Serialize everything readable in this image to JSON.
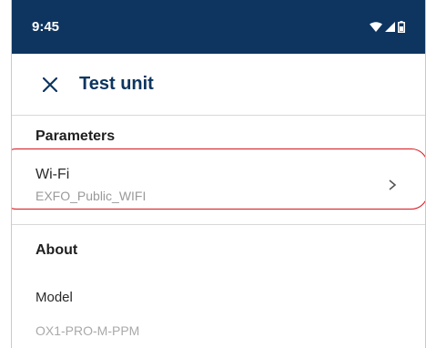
{
  "status_bar": {
    "time": "9:45",
    "icons": [
      "wifi-icon",
      "signal-icon",
      "battery-icon"
    ]
  },
  "app_bar": {
    "close_icon": "close-icon",
    "title": "Test unit"
  },
  "parameters": {
    "header": "Parameters",
    "wifi": {
      "label": "Wi-Fi",
      "value": "EXFO_Public_WIFI",
      "chevron_icon": "chevron-right-icon"
    }
  },
  "about": {
    "header": "About",
    "model_label": "Model",
    "model_value": "OX1-PRO-M-PPM"
  },
  "colors": {
    "status_bar_bg": "#0d3560",
    "title": "#0d3560",
    "highlight": "#d8141e"
  }
}
